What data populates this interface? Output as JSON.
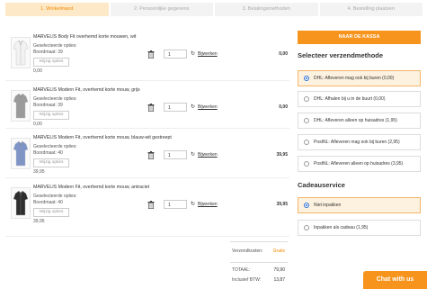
{
  "steps": [
    {
      "label": "1. Winkelmand",
      "active": true
    },
    {
      "label": "2. Persoonlijke gegevens",
      "active": false
    },
    {
      "label": "3. Betalingsmethoden",
      "active": false
    },
    {
      "label": "4. Bestelling plaatsen",
      "active": false
    }
  ],
  "cart": {
    "options_title": "Geselecteerde opties:",
    "edit_label": "Wijzig opties",
    "update_label": "Bijwerken",
    "items": [
      {
        "name": "MARVELIS Body Fit overhemd korte mouwen, wit",
        "size": "Boordmaat: 39",
        "price": "0,00",
        "qty": "1",
        "total": "0,00",
        "shirt_color": "#f2f2f2"
      },
      {
        "name": "MARVELIS Modern Fit, overhemd korte mouw, grijs",
        "size": "Boordmaat: 39",
        "price": "0,00",
        "qty": "1",
        "total": "0,00",
        "shirt_color": "#9a9a9a"
      },
      {
        "name": "MARVELIS Modern Fit, overhemd korte mouw, blauw-wit gestreept",
        "size": "Boordmaat: 40",
        "price": "39,95",
        "qty": "1",
        "total": "39,95",
        "shirt_color": "#7f95c8"
      },
      {
        "name": "MARVELIS Modern Fit, overhemd korte mouw, antraciet",
        "size": "Boordmaat: 40",
        "price": "39,95",
        "qty": "1",
        "total": "39,95",
        "shirt_color": "#2e2e2e"
      }
    ]
  },
  "totals": {
    "shipping_label": "Verzendkosten:",
    "shipping_value": "Gratis",
    "total_label": "TOTAAL:",
    "total_value": "79,90",
    "vat_label": "Inclusief BTW:",
    "vat_value": "13,87"
  },
  "checkout_label": "NAAR DE KASSA",
  "shipping": {
    "title": "Selecteer verzendmethode",
    "options": [
      {
        "label": "DHL: Afleveren mag ook bij buren (0,00)",
        "selected": true
      },
      {
        "label": "DHL: Afhalen bij u in de buurt (0,00)",
        "selected": false
      },
      {
        "label": "DHL: Afleveren alleen op huisadres (1,95)",
        "selected": false
      },
      {
        "label": "PostNL: Afleveren mag ook bij buren (2,95)",
        "selected": false
      },
      {
        "label": "PostNL: Afleveren alleen op huisadres (3,95)",
        "selected": false
      }
    ]
  },
  "gift": {
    "title": "Cadeauservice",
    "options": [
      {
        "label": "Niet inpakken",
        "selected": true
      },
      {
        "label": "Inpakken als cadeau (1,95)",
        "selected": false
      }
    ]
  },
  "chat_label": "Chat with us",
  "colors": {
    "accent": "#f7941d",
    "radio": "#2b6fd6"
  }
}
